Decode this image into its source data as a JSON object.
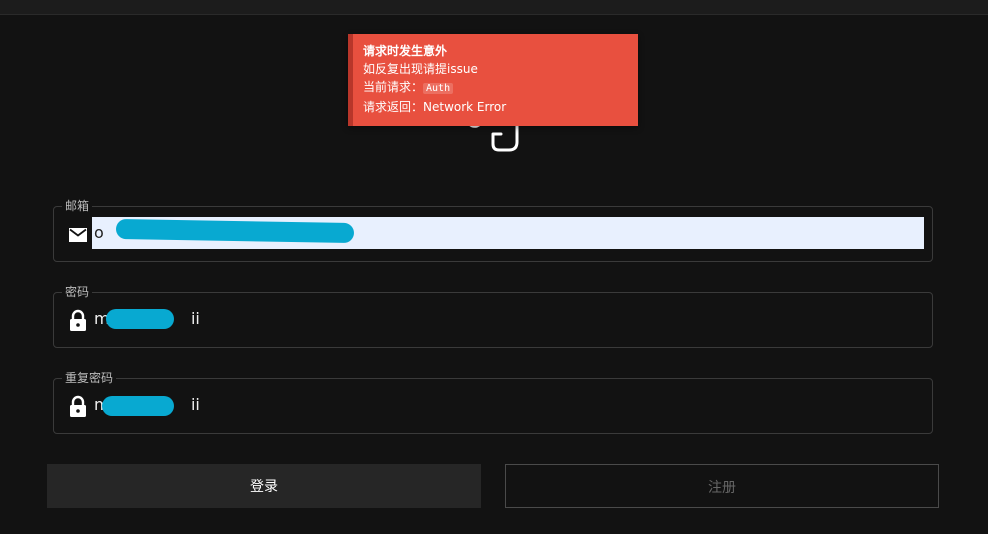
{
  "toast": {
    "title": "请求时发生意外",
    "line1": "如反复出现请提issue",
    "request_label": "当前请求：",
    "request_value": "Auth",
    "response_label": "请求返回：",
    "response_value": "Network Error"
  },
  "form": {
    "email": {
      "label": "邮箱",
      "value": "o",
      "icon": "mail-icon"
    },
    "password": {
      "label": "密码",
      "value": "m                ii",
      "icon": "lock-icon"
    },
    "confirm_password": {
      "label": "重复密码",
      "value": "m                ii",
      "icon": "lock-icon"
    }
  },
  "buttons": {
    "login": "登录",
    "register": "注册"
  },
  "colors": {
    "background": "#121212",
    "toast_error": "#e8503f",
    "autofill": "#e8f0fe",
    "redaction": "#08a9d1"
  }
}
